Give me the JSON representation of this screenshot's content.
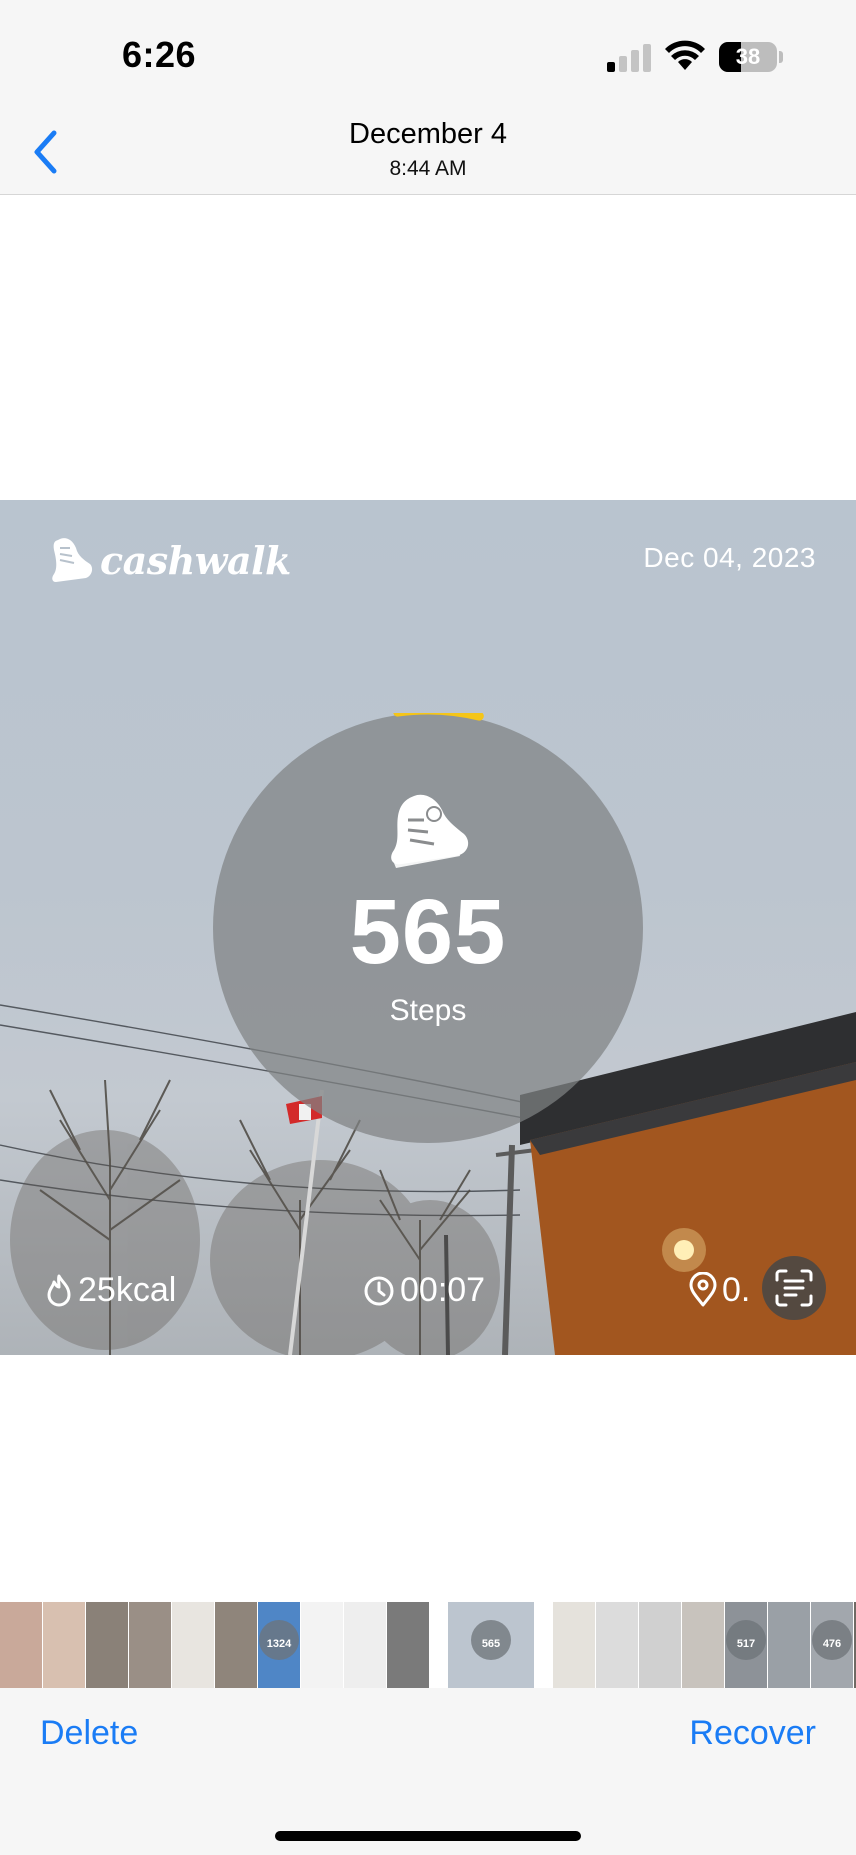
{
  "status_bar": {
    "time": "6:26",
    "battery_level": "38",
    "battery_fraction": 0.38,
    "signal_bars_active": 1,
    "signal_bars_total": 4
  },
  "nav": {
    "back_icon": "chevron-left-icon",
    "title": "December 4",
    "subtitle": "8:44 AM"
  },
  "photo": {
    "brand": "cashwalk",
    "date": "Dec 04, 2023",
    "steps": "565",
    "steps_label": "Steps",
    "step_progress_fraction": 0.06,
    "kcal": "25kcal",
    "duration": "00:07",
    "distance_partial": "0.",
    "icons": {
      "brand": "shoe-icon",
      "kcal": "flame-icon",
      "duration": "clock-icon",
      "distance": "location-pin-icon",
      "live_text": "live-text-icon"
    },
    "colors": {
      "progress": "#f5c518"
    }
  },
  "thumbnails": {
    "items": [
      {
        "label": "",
        "color": "#c9a99a"
      },
      {
        "label": "",
        "color": "#d8c0b0"
      },
      {
        "label": "",
        "color": "#8a8178"
      },
      {
        "label": "",
        "color": "#9a8f86"
      },
      {
        "label": "",
        "color": "#e8e5e0"
      },
      {
        "label": "",
        "color": "#8f857b"
      },
      {
        "label": "1324",
        "color": "#4f86c6"
      },
      {
        "label": "",
        "color": "#f3f3f3"
      },
      {
        "label": "",
        "color": "#eeeeee"
      },
      {
        "label": "",
        "color": "#7a7a7a"
      },
      {
        "label": "565",
        "color": "#bcc5cf"
      },
      {
        "label": "",
        "color": "#e5e2dc"
      },
      {
        "label": "",
        "color": "#dcdcdc"
      },
      {
        "label": "",
        "color": "#d0d0d0"
      },
      {
        "label": "",
        "color": "#c8c3bd"
      },
      {
        "label": "517",
        "color": "#8d9298"
      },
      {
        "label": "",
        "color": "#9aa0a6"
      },
      {
        "label": "476",
        "color": "#a2a7ad"
      },
      {
        "label": "",
        "color": "#6f6a64"
      },
      {
        "label": "",
        "color": "#b7b0a7"
      }
    ]
  },
  "toolbar": {
    "delete_label": "Delete",
    "recover_label": "Recover"
  }
}
